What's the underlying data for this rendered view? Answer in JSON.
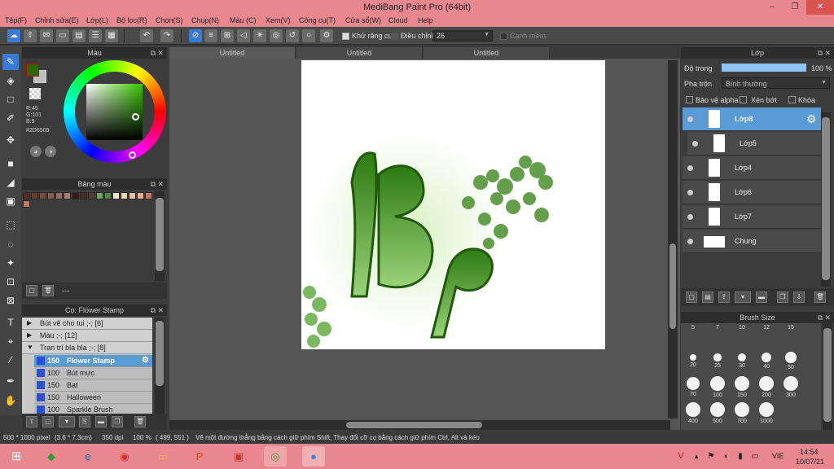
{
  "window": {
    "title": "MediBang Paint Pro (64bit)",
    "minimize_glyph": "–",
    "restore_glyph": "❐",
    "close_glyph": "✕"
  },
  "menu": [
    "Tệp(F)",
    "Chỉnh sửa(E)",
    "Lớp(L)",
    "Bộ lọc(R)",
    "Chọn(S)",
    "Chụp(N)",
    "Màu (C)",
    "Xem(V)",
    "Công cụ(T)",
    "Cửa sổ(W)",
    "Cloud",
    "Help"
  ],
  "toolbar": {
    "antialias_label": "Khử răng cưa",
    "correction_label": "Điều chỉnh",
    "correction_value": "26",
    "smooth_label": "Cạnh mềm"
  },
  "color_panel": {
    "title": "Màu",
    "r": "R:45",
    "g": "G:101",
    "b": "B:9",
    "hex": "#2D6509",
    "fg_color": "#2d6509",
    "bg_color": "#c0c0c0"
  },
  "palette_panel": {
    "title": "Bảng màu",
    "swatches": [
      "#5a2a1e",
      "#6e3a2a",
      "#7a4a3a",
      "#8a5a4a",
      "#9a6a5a",
      "#aa7a6a",
      "#3a1a10",
      "#4a2a1e",
      "#5a3a2e",
      "#6aa85a",
      "#4a8a3a",
      "#f5e6c8",
      "#f5d0a0",
      "#e8c0a0",
      "#f0a888",
      "#c87858"
    ]
  },
  "brush_panel": {
    "title": "Cọ: Flower Stamp",
    "groups": [
      {
        "arrow": "▶",
        "name": "Bút vẽ cho tui ;-; [6]"
      },
      {
        "arrow": "▶",
        "name": "Màu ;-; [12]"
      },
      {
        "arrow": "▼",
        "name": "Tran trí bla bla ;-; [8]"
      }
    ],
    "items": [
      {
        "size": "150",
        "name": "Flower Stamp",
        "selected": true
      },
      {
        "size": "100",
        "name": "Bút mực",
        "selected": false
      },
      {
        "size": "150",
        "name": "Bat",
        "selected": false
      },
      {
        "size": "150",
        "name": "Halloween",
        "selected": false
      },
      {
        "size": "100",
        "name": "Sparkle Brush",
        "selected": false
      }
    ]
  },
  "palette_footer": "---",
  "canvas": {
    "tabs": [
      "Untitled",
      "Untitled",
      "Untitled"
    ]
  },
  "layer_panel": {
    "title": "Lớp",
    "opacity_label": "Độ trong",
    "opacity_value": "100 %",
    "opacity": 100,
    "blend_label": "Pha trộn",
    "blend_value": "Bình thường",
    "protect_alpha": "Bảo vệ alpha",
    "clipping": "Xén bớt",
    "lock": "Khóa",
    "layers": [
      "Lớp8",
      "Lớp5",
      "Lớp4",
      "Lớp6",
      "Lớp7",
      "Chung"
    ]
  },
  "brush_size_panel": {
    "title": "Brush Size",
    "row0": [
      "5",
      "7",
      "10",
      "12",
      "15"
    ],
    "row1": [
      "20",
      "25",
      "30",
      "40",
      "50"
    ],
    "row2": [
      "70",
      "100",
      "150",
      "200",
      "300"
    ],
    "row3": [
      "400",
      "500",
      "700",
      "1000"
    ]
  },
  "status": {
    "size": "500 * 1000 pixel",
    "dims": "(3.6 * 7.3cm)",
    "dpi": "350 dpi",
    "zoom": "100 %",
    "coords": "( 499, 551 )",
    "hint": "Vẽ một đường thẳng bằng cách giữ phím Shift, Thay đổi cỡ cọ bằng cách giữ phím Ctrl, Alt và kéo"
  },
  "taskbar": {
    "lang": "VIE",
    "time": "14:54",
    "date": "10/07/21"
  }
}
